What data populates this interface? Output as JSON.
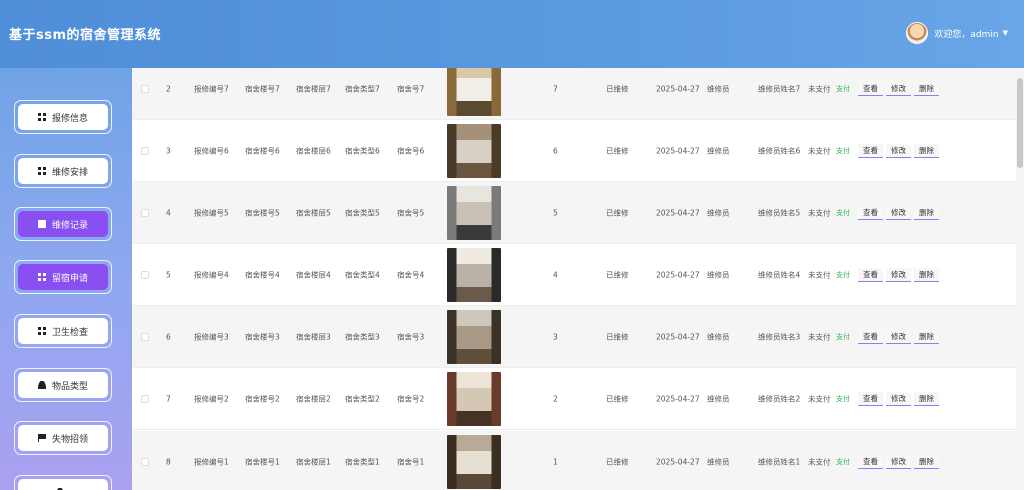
{
  "app": {
    "title": "基于ssm的宿舍管理系统"
  },
  "user": {
    "greeting": "欢迎您，admin"
  },
  "sidebar": {
    "items": [
      {
        "label": "报修信息",
        "icon": "grid-icon",
        "active": false
      },
      {
        "label": "维修安排",
        "icon": "grid-icon",
        "active": false
      },
      {
        "label": "维修记录",
        "icon": "monitor-icon",
        "active": true
      },
      {
        "label": "留宿申请",
        "icon": "grid-icon",
        "active": true
      },
      {
        "label": "卫生检查",
        "icon": "grid-icon",
        "active": false
      },
      {
        "label": "物品类型",
        "icon": "person-icon",
        "active": false
      },
      {
        "label": "失物招领",
        "icon": "flag-icon",
        "active": false
      }
    ]
  },
  "actions": {
    "view": "查看",
    "edit": "修改",
    "delete": "删除",
    "pay": "支付"
  },
  "rows": [
    {
      "idx": "2",
      "repair_no": "报修编号7",
      "building": "宿舍楼号7",
      "floor": "宿舍楼层7",
      "room_type": "宿舍类型7",
      "room_no": "宿舍号7",
      "num": "7",
      "status": "已维修",
      "date": "2025-04-27",
      "worker": "维修员",
      "worker_name": "维修员姓名7",
      "pay_status": "未支付"
    },
    {
      "idx": "3",
      "repair_no": "报修编号6",
      "building": "宿舍楼号6",
      "floor": "宿舍楼层6",
      "room_type": "宿舍类型6",
      "room_no": "宿舍号6",
      "num": "6",
      "status": "已维修",
      "date": "2025-04-27",
      "worker": "维修员",
      "worker_name": "维修员姓名6",
      "pay_status": "未支付"
    },
    {
      "idx": "4",
      "repair_no": "报修编号5",
      "building": "宿舍楼号5",
      "floor": "宿舍楼层5",
      "room_type": "宿舍类型5",
      "room_no": "宿舍号5",
      "num": "5",
      "status": "已维修",
      "date": "2025-04-27",
      "worker": "维修员",
      "worker_name": "维修员姓名5",
      "pay_status": "未支付"
    },
    {
      "idx": "5",
      "repair_no": "报修编号4",
      "building": "宿舍楼号4",
      "floor": "宿舍楼层4",
      "room_type": "宿舍类型4",
      "room_no": "宿舍号4",
      "num": "4",
      "status": "已维修",
      "date": "2025-04-27",
      "worker": "维修员",
      "worker_name": "维修员姓名4",
      "pay_status": "未支付"
    },
    {
      "idx": "6",
      "repair_no": "报修编号3",
      "building": "宿舍楼号3",
      "floor": "宿舍楼层3",
      "room_type": "宿舍类型3",
      "room_no": "宿舍号3",
      "num": "3",
      "status": "已维修",
      "date": "2025-04-27",
      "worker": "维修员",
      "worker_name": "维修员姓名3",
      "pay_status": "未支付"
    },
    {
      "idx": "7",
      "repair_no": "报修编号2",
      "building": "宿舍楼号2",
      "floor": "宿舍楼层2",
      "room_type": "宿舍类型2",
      "room_no": "宿舍号2",
      "num": "2",
      "status": "已维修",
      "date": "2025-04-27",
      "worker": "维修员",
      "worker_name": "维修员姓名2",
      "pay_status": "未支付"
    },
    {
      "idx": "8",
      "repair_no": "报修编号1",
      "building": "宿舍楼号1",
      "floor": "宿舍楼层1",
      "room_type": "宿舍类型1",
      "room_no": "宿舍号1",
      "num": "1",
      "status": "已维修",
      "date": "2025-04-27",
      "worker": "维修员",
      "worker_name": "维修员姓名1",
      "pay_status": "未支付"
    }
  ],
  "colors": {
    "header": "#4f8ed8",
    "accent": "#8a4ff0",
    "pay_link": "#2db55d"
  }
}
